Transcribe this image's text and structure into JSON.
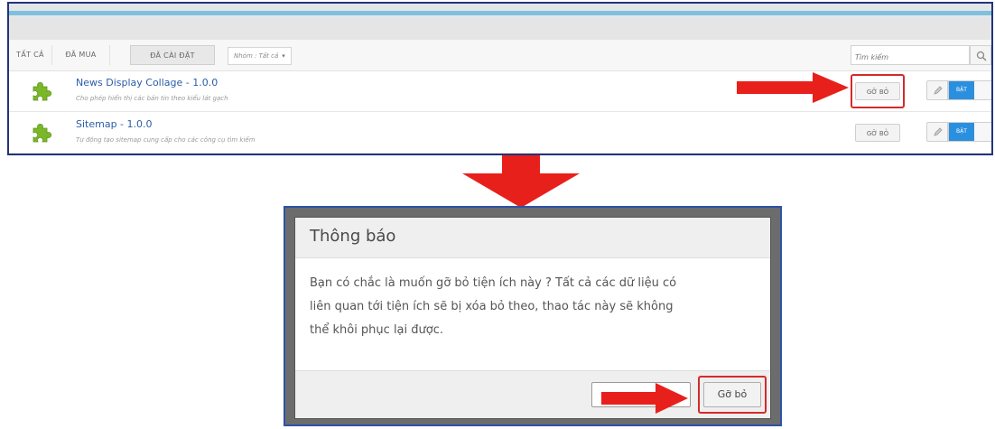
{
  "toolbar": {
    "tabs": [
      "TẤT CẢ",
      "ĐÃ MUA",
      "ĐÃ CÀI ĐẶT"
    ],
    "group_label": "Nhóm : Tất cả",
    "search_placeholder": "Tìm kiếm"
  },
  "plugins": [
    {
      "title": "News Display Collage - 1.0.0",
      "description": "Cho phép hiển thị các bản tin theo kiểu lát gạch",
      "uninstall": "GỠ BỎ",
      "toggle": "BẬT"
    },
    {
      "title": "Sitemap - 1.0.0",
      "description": "Tự động tạo sitemap cung cấp cho các công cụ tìm kiếm",
      "uninstall": "GỠ BỎ",
      "toggle": "BẬT"
    }
  ],
  "dialog": {
    "title": "Thông báo",
    "message_lines": [
      "Bạn có chắc là muốn gỡ bỏ tiện ích này ? Tất cả các dữ liệu có",
      "liên quan tới tiện ích sẽ bị xóa bỏ theo, thao tác này sẽ không",
      "thể khôi phục lại được."
    ],
    "confirm": "Gỡ bỏ"
  },
  "colors": {
    "accent_blue": "#2b8fe0",
    "link_blue": "#2b5da8",
    "highlight_red": "#d42a2a",
    "arrow_red": "#e8201c",
    "frame_blue": "#21357a"
  },
  "icons": [
    "puzzle-icon",
    "search-icon",
    "pencil-icon",
    "arrow-right-icon",
    "arrow-down-icon"
  ]
}
